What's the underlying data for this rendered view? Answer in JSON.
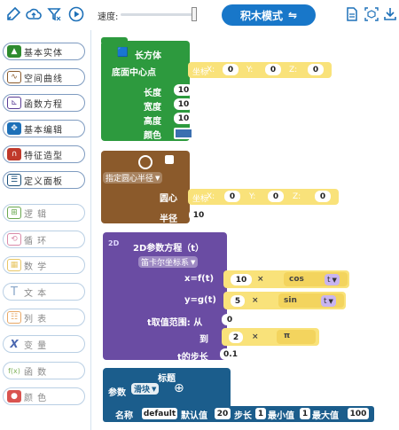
{
  "toolbar": {
    "speed_label": "速度:",
    "speed_value": 1.0,
    "mode_button_label": "积木模式",
    "mode_button_icon": "⇋"
  },
  "sidebar": {
    "items": [
      {
        "label": "基本实体",
        "icon": "cube-icon",
        "color": "#2e8b2e"
      },
      {
        "label": "空间曲线",
        "icon": "curve-icon",
        "color": "#8a5a2b"
      },
      {
        "label": "函数方程",
        "icon": "function-graph-icon",
        "color": "#5b3e96"
      },
      {
        "label": "基本编辑",
        "icon": "move-arrows-icon",
        "color": "#1d70b8"
      },
      {
        "label": "特征造型",
        "icon": "magnet-icon",
        "color": "#c0392b"
      },
      {
        "label": "定义面板",
        "icon": "panel-icon",
        "color": "#1a4f7a"
      },
      {
        "label": "逻  辑",
        "icon": "logic-icon",
        "color": "#6aa84f"
      },
      {
        "label": "循  环",
        "icon": "loop-icon",
        "color": "#d98aa8"
      },
      {
        "label": "数  学",
        "icon": "math-icon",
        "color": "#e8c766"
      },
      {
        "label": "文  本",
        "icon": "text-icon",
        "color": "#88a6c8"
      },
      {
        "label": "列  表",
        "icon": "list-icon",
        "color": "#e8a866"
      },
      {
        "label": "变  量",
        "icon": "variable-icon",
        "color": "#4a67b0"
      },
      {
        "label": "函  数",
        "icon": "fx-icon",
        "color": "#7fb25a"
      },
      {
        "label": "颜  色",
        "icon": "palette-icon",
        "color": "#d9534f"
      }
    ]
  },
  "blocks": {
    "cuboid": {
      "title": "长方体",
      "base_center_label": "底面中心点",
      "coord_label": "坐标",
      "x_label": "X:",
      "x_value": "0",
      "y_label": "Y:",
      "y_value": "0",
      "z_label": "Z:",
      "z_value": "0",
      "length_label": "长度",
      "length_value": "10",
      "width_label": "宽度",
      "width_value": "10",
      "height_label": "高度",
      "height_value": "10",
      "color_label": "颜色",
      "color_value": "#3b6fb0",
      "color": "#2d9a3e"
    },
    "circle": {
      "mode_label": "指定圆心半径",
      "center_label": "圆心",
      "coord_label": "坐标",
      "x_label": "X:",
      "x_value": "0",
      "y_label": "Y:",
      "y_value": "0",
      "z_label": "Z:",
      "z_value": "0",
      "radius_label": "半径",
      "radius_value": "10",
      "color": "#8b5a2b"
    },
    "param2d": {
      "title": "2D参数方程（t）",
      "coord_system": "笛卡尔坐标系",
      "x_label": "x=f(t)",
      "x_num": "10",
      "x_op": "×",
      "x_func": "cos",
      "x_var": "t",
      "y_label": "y=g(t)",
      "y_num": "5",
      "y_op": "×",
      "y_func": "sin",
      "y_var": "t",
      "range_label": "t取值范围: 从",
      "range_from": "0",
      "to_label": "到",
      "to_num": "2",
      "to_op": "×",
      "to_const": "π",
      "step_label": "t的步长",
      "step_value": "0.1",
      "color": "#6a4ca3"
    },
    "panel": {
      "title": "标题",
      "param_label": "参数",
      "param_type": "滑块",
      "add_icon": "⊕",
      "name_label": "名称",
      "name_value": "default",
      "default_label": "默认值",
      "default_value": "20",
      "step_label": "步长",
      "step_value": "1",
      "min_label": "最小值",
      "min_value": "1",
      "max_label": "最大值",
      "max_value": "100",
      "color": "#1b5d8c"
    }
  }
}
